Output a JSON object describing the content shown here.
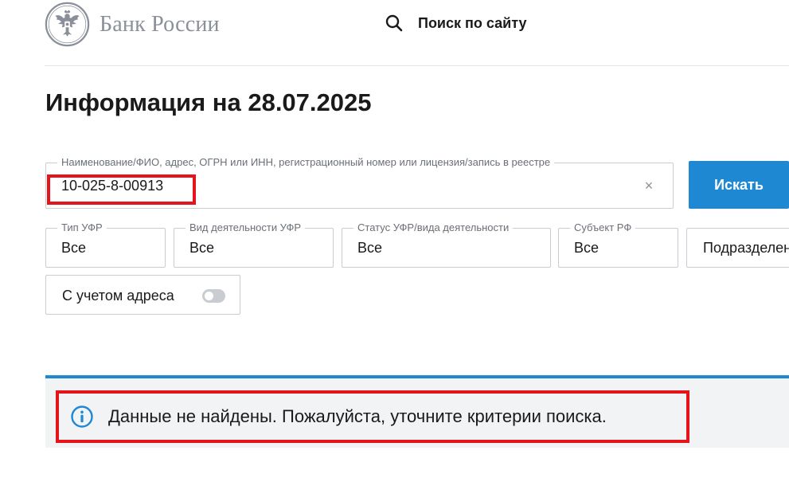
{
  "header": {
    "logo_text": "Банк России",
    "site_search_label": "Поиск по сайту"
  },
  "page": {
    "title": "Информация на 28.07.2025"
  },
  "search": {
    "legend": "Наименование/ФИО, адрес, ОГРН или ИНН, регистрационный номер или лицензия/запись в реестре",
    "value": "10-025-8-00913",
    "clear_symbol": "×",
    "button_label": "Искать"
  },
  "filters": [
    {
      "legend": "Тип УФР",
      "value": "Все"
    },
    {
      "legend": "Вид деятельности УФР",
      "value": "Все"
    },
    {
      "legend": "Статус УФР/вида деятельности",
      "value": "Все"
    },
    {
      "legend": "Субъект РФ",
      "value": "Все"
    },
    {
      "legend": "",
      "value": "Подразделение"
    }
  ],
  "address_toggle": {
    "label": "С учетом адреса",
    "checked": false
  },
  "result": {
    "message": "Данные не найдены. Пожалуйста, уточните критерии поиска."
  },
  "colors": {
    "accent": "#1e88d2",
    "highlight": "#e5141a",
    "logo_gray": "#8a8f99",
    "panel_bg": "#f2f3f5"
  },
  "icons": {
    "logo": "double-headed-eagle-icon",
    "site_search": "search-icon",
    "clear": "close-icon",
    "result": "info-icon"
  }
}
